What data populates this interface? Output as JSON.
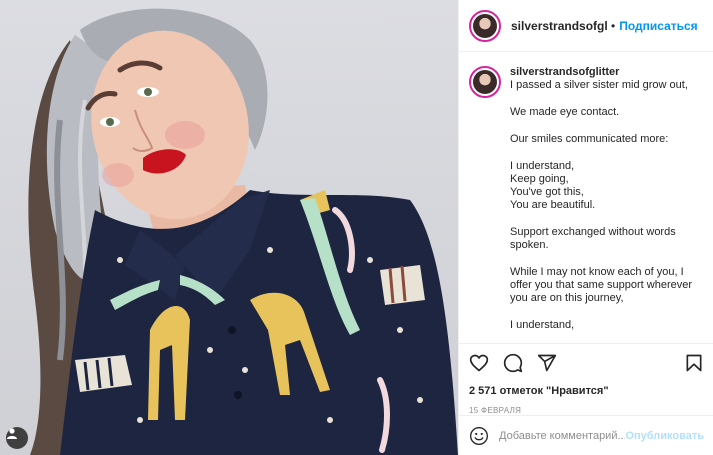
{
  "header": {
    "username": "silverstrandsofglitter",
    "separator": "•",
    "follow_label": "Подписаться"
  },
  "caption": {
    "username": "silverstrandsofglitter",
    "lines": [
      "I passed a silver sister mid grow out,",
      "",
      "We made eye contact.",
      "",
      "Our smiles communicated more:",
      "",
      "I understand,",
      "Keep going,",
      "You've got this,",
      "You are beautiful.",
      "",
      "Support exchanged without words",
      "spoken.",
      "",
      "While I may not know each of you, I",
      "offer you that same support wherever",
      "you are on this journey,",
      "",
      "I understand,"
    ]
  },
  "actions": {
    "icons": [
      "heart-icon",
      "comment-icon",
      "share-icon",
      "bookmark-icon"
    ],
    "likes_text": "2 571 отметок \"Нравится\"",
    "date": "15 ФЕВРАЛЯ"
  },
  "comment": {
    "placeholder": "Добавьте комментарий...",
    "publish_label": "Опубликовать"
  },
  "photo": {
    "description_icon": "user-tag-icon"
  },
  "colors": {
    "link_blue": "#0095f6",
    "publish_disabled": "#b2dffc",
    "border": "#efefef",
    "text": "#262626",
    "muted": "#8e8e8e"
  }
}
